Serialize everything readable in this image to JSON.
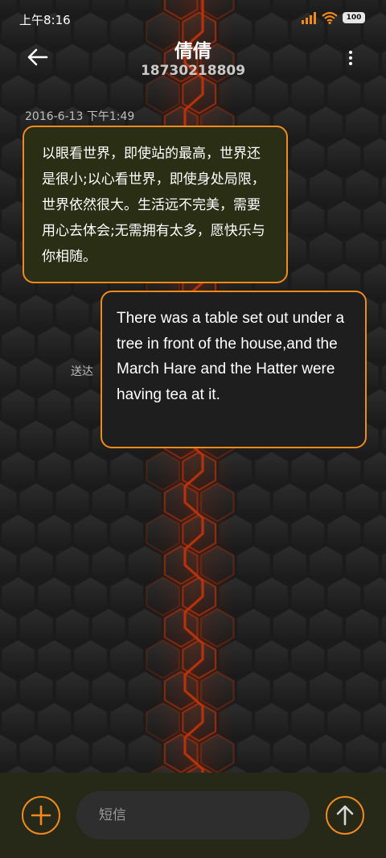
{
  "status_bar": {
    "time": "上午8:16",
    "battery": "100",
    "icons": [
      "signal-icon",
      "wifi-icon",
      "battery-icon"
    ]
  },
  "header": {
    "contact_name": "倩倩",
    "contact_number": "18730218809",
    "icons": [
      "back-arrow-icon",
      "more-vertical-icon"
    ]
  },
  "conversation": {
    "timestamp": "2016-6-13 下午1:49",
    "messages": [
      {
        "direction": "received",
        "text": "以眼看世界，即使站的最高，世界还是很小;以心看世界，即使身处局限，世界依然很大。生活远不完美，需要用心去体会;无需拥有太多，愿快乐与你相随。"
      },
      {
        "direction": "sent",
        "text": "There was a table set out under a tree in front of the house,and the March Hare and the Hatter were having tea at it.",
        "status": "送达"
      }
    ]
  },
  "compose": {
    "placeholder": "短信",
    "icons": [
      "plus-icon",
      "send-arrow-icon"
    ]
  },
  "colors": {
    "accent": "#f0891e",
    "background": "#1c1c1c",
    "received_bubble": "#2a2e14",
    "sent_bubble": "#1e1e1e",
    "compose_bar": "#262818",
    "glow": "#c2330a"
  }
}
